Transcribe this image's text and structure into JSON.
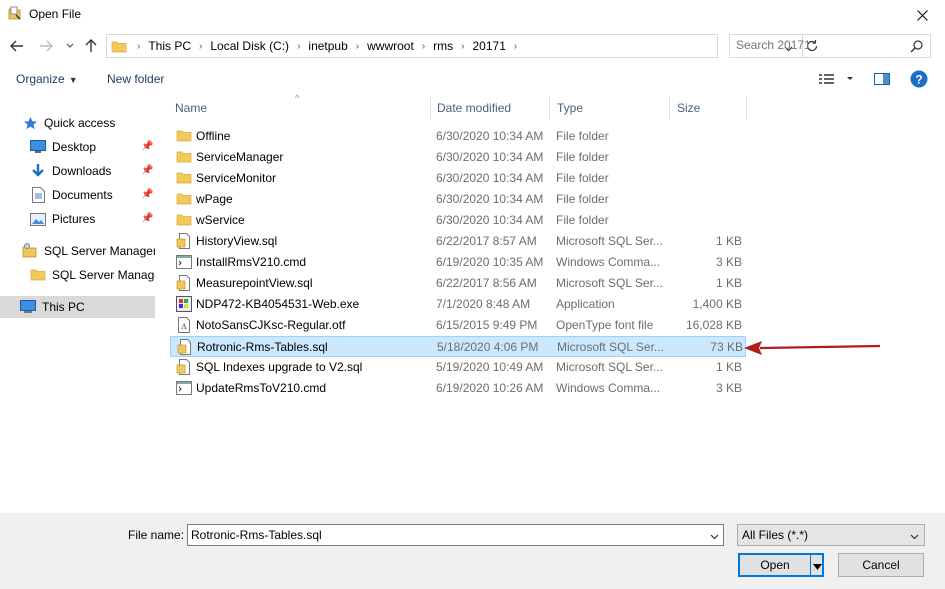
{
  "window": {
    "title": "Open File"
  },
  "address": {
    "crumbs": [
      "This PC",
      "Local Disk (C:)",
      "inetpub",
      "wwwroot",
      "rms",
      "20171"
    ]
  },
  "search": {
    "placeholder": "Search 20171"
  },
  "commands": {
    "organize": "Organize",
    "new_folder": "New folder"
  },
  "nav": {
    "quick_access": "Quick access",
    "desktop": "Desktop",
    "downloads": "Downloads",
    "documents": "Documents",
    "pictures": "Pictures",
    "sql_mgmt": "SQL Server Managem",
    "sql_mgmt_folder": "SQL Server Manage",
    "this_pc": "This PC"
  },
  "columns": {
    "name": "Name",
    "date": "Date modified",
    "type": "Type",
    "size": "Size"
  },
  "files": [
    {
      "name": "Offline",
      "date": "6/30/2020 10:34 AM",
      "type": "File folder",
      "size": "",
      "icon": "folder"
    },
    {
      "name": "ServiceManager",
      "date": "6/30/2020 10:34 AM",
      "type": "File folder",
      "size": "",
      "icon": "folder"
    },
    {
      "name": "ServiceMonitor",
      "date": "6/30/2020 10:34 AM",
      "type": "File folder",
      "size": "",
      "icon": "folder"
    },
    {
      "name": "wPage",
      "date": "6/30/2020 10:34 AM",
      "type": "File folder",
      "size": "",
      "icon": "folder"
    },
    {
      "name": "wService",
      "date": "6/30/2020 10:34 AM",
      "type": "File folder",
      "size": "",
      "icon": "folder"
    },
    {
      "name": "HistoryView.sql",
      "date": "6/22/2017 8:57 AM",
      "type": "Microsoft SQL Ser...",
      "size": "1 KB",
      "icon": "sql"
    },
    {
      "name": "InstallRmsV210.cmd",
      "date": "6/19/2020 10:35 AM",
      "type": "Windows Comma...",
      "size": "3 KB",
      "icon": "cmd"
    },
    {
      "name": "MeasurepointView.sql",
      "date": "6/22/2017 8:56 AM",
      "type": "Microsoft SQL Ser...",
      "size": "1 KB",
      "icon": "sql"
    },
    {
      "name": "NDP472-KB4054531-Web.exe",
      "date": "7/1/2020 8:48 AM",
      "type": "Application",
      "size": "1,400 KB",
      "icon": "exe"
    },
    {
      "name": "NotoSansCJKsc-Regular.otf",
      "date": "6/15/2015 9:49 PM",
      "type": "OpenType font file",
      "size": "16,028 KB",
      "icon": "font"
    },
    {
      "name": "Rotronic-Rms-Tables.sql",
      "date": "5/18/2020 4:06 PM",
      "type": "Microsoft SQL Ser...",
      "size": "73 KB",
      "icon": "sql",
      "selected": true
    },
    {
      "name": "SQL Indexes upgrade to V2.sql",
      "date": "5/19/2020 10:49 AM",
      "type": "Microsoft SQL Ser...",
      "size": "1 KB",
      "icon": "sql"
    },
    {
      "name": "UpdateRmsToV210.cmd",
      "date": "6/19/2020 10:26 AM",
      "type": "Windows Comma...",
      "size": "3 KB",
      "icon": "cmd"
    }
  ],
  "bottom": {
    "file_name_label": "File name:",
    "file_name_value": "Rotronic-Rms-Tables.sql",
    "filter": "All Files (*.*)",
    "open": "Open",
    "cancel": "Cancel"
  },
  "colors": {
    "selection": "#cce8ff",
    "selection_border": "#99d1ff",
    "arrow": "#b31b1b",
    "accent": "#0078d7"
  }
}
